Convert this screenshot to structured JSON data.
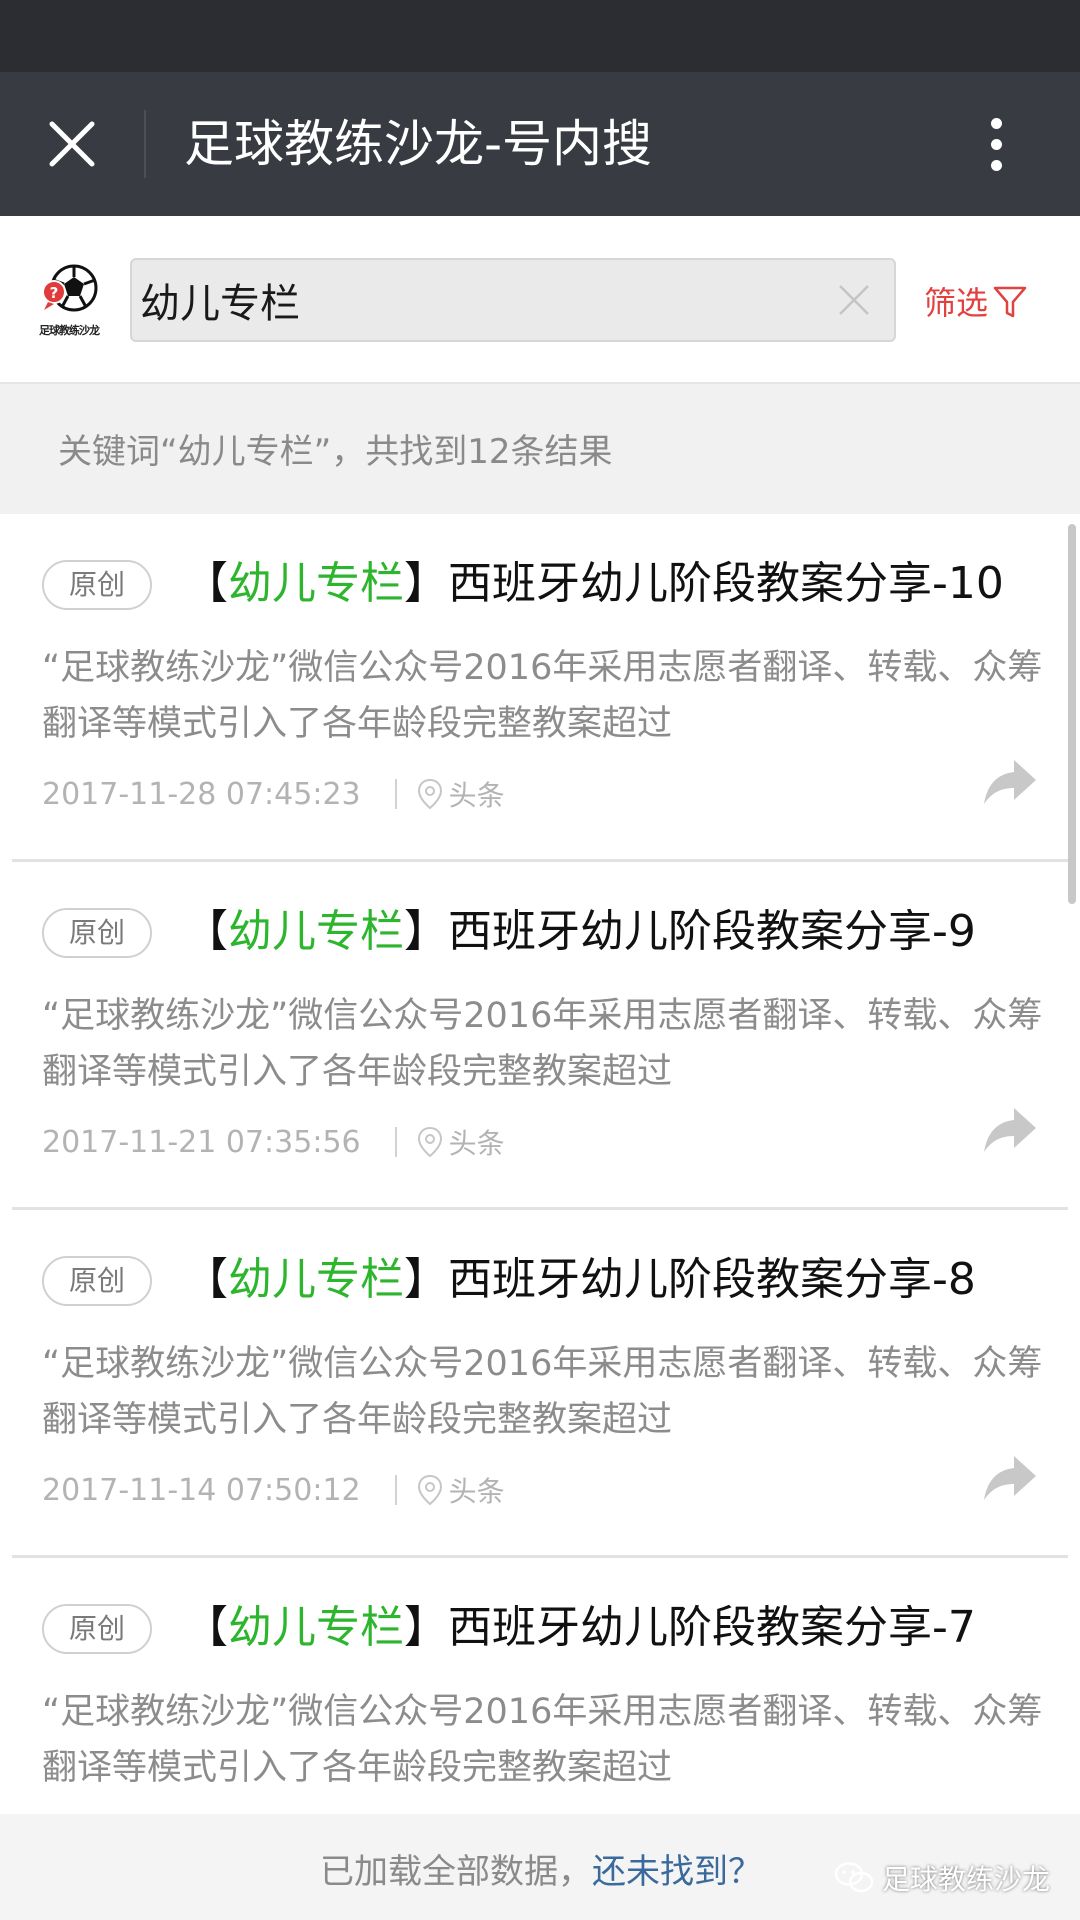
{
  "window": {
    "title": "足球教练沙龙-号内搜"
  },
  "account": {
    "logo_caption": "足球教练沙龙"
  },
  "search": {
    "query": "幼儿专栏",
    "filter_label": "筛选"
  },
  "results_info": "关键词“幼儿专栏”，共找到12条结果",
  "results": [
    {
      "badge": "原创",
      "title_open": "【",
      "title_keyword": "幼儿专栏",
      "title_rest": "】西班牙幼儿阶段教案分享-10",
      "snippet": "“足球教练沙龙”微信公众号2016年采用志愿者翻译、转载、众筹翻译等模式引入了各年龄段完整教案超过",
      "date": "2017-11-28 07:45:23",
      "tag": "头条"
    },
    {
      "badge": "原创",
      "title_open": "【",
      "title_keyword": "幼儿专栏",
      "title_rest": "】西班牙幼儿阶段教案分享-9",
      "snippet": "“足球教练沙龙”微信公众号2016年采用志愿者翻译、转载、众筹翻译等模式引入了各年龄段完整教案超过",
      "date": "2017-11-21 07:35:56",
      "tag": "头条"
    },
    {
      "badge": "原创",
      "title_open": "【",
      "title_keyword": "幼儿专栏",
      "title_rest": "】西班牙幼儿阶段教案分享-8",
      "snippet": "“足球教练沙龙”微信公众号2016年采用志愿者翻译、转载、众筹翻译等模式引入了各年龄段完整教案超过",
      "date": "2017-11-14 07:50:12",
      "tag": "头条"
    },
    {
      "badge": "原创",
      "title_open": "【",
      "title_keyword": "幼儿专栏",
      "title_rest": "】西班牙幼儿阶段教案分享-7",
      "snippet": "“足球教练沙龙”微信公众号2016年采用志愿者翻译、转载、众筹翻译等模式引入了各年龄段完整教案超过"
    }
  ],
  "footer": {
    "loaded_text": "已加载全部数据，",
    "link_text": "还未找到？",
    "watermark": "足球教练沙龙"
  },
  "icons": {
    "close": "close-icon",
    "more": "more-vertical-icon",
    "clear": "clear-icon",
    "filter": "filter-funnel-icon",
    "location": "location-pin-icon",
    "share": "share-arrow-icon",
    "wechat": "wechat-icon"
  },
  "colors": {
    "title_bar": "#383b42",
    "status_bar": "#2b2d32",
    "keyword_highlight": "#2db52d",
    "filter": "#e0423f",
    "link": "#3a6a9c"
  }
}
